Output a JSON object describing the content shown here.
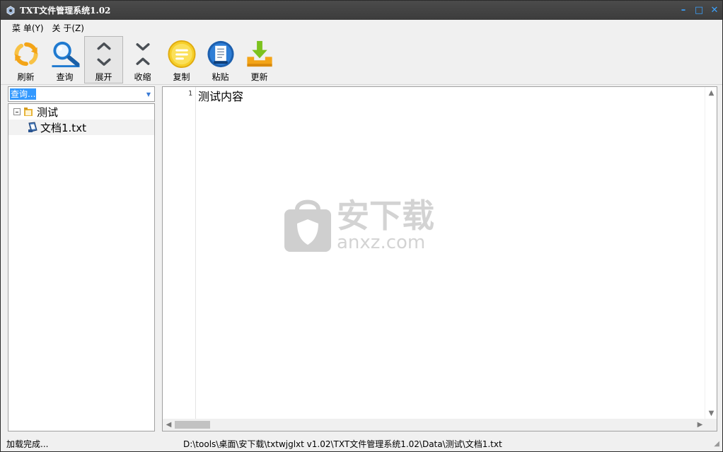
{
  "window": {
    "title": "TXT文件管理系统1.02",
    "controls": {
      "minimize": "–",
      "maximize": "□",
      "close": "✕"
    }
  },
  "menu": [
    {
      "label": "菜 单(Y)"
    },
    {
      "label": "关 于(Z)"
    }
  ],
  "toolbar": {
    "refresh": {
      "label": "刷新",
      "icon": "refresh-icon"
    },
    "search": {
      "label": "查询",
      "icon": "magnifier-icon"
    },
    "expand": {
      "label": "展开",
      "icon": "chevrons-expand-icon"
    },
    "collapse": {
      "label": "收缩",
      "icon": "chevrons-collapse-icon"
    },
    "copy": {
      "label": "复制",
      "icon": "copy-icon"
    },
    "paste": {
      "label": "粘贴",
      "icon": "paste-icon"
    },
    "update": {
      "label": "更新",
      "icon": "download-icon"
    }
  },
  "search_combo": {
    "value": "查询..."
  },
  "tree": {
    "folder": {
      "label": "测试",
      "expanded": true
    },
    "file": {
      "label": "文档1.txt",
      "selected": true
    }
  },
  "editor": {
    "line_number": "1",
    "content": "测试内容"
  },
  "watermark": {
    "cn": "安下载",
    "en": "anxz.com"
  },
  "status": {
    "message": "加载完成...",
    "path": "D:\\tools\\桌面\\安下载\\txtwjglxt v1.02\\TXT文件管理系统1.02\\Data\\测试\\文档1.txt"
  },
  "colors": {
    "titlebar": "#3c3c3c",
    "accent": "#3ba2ff",
    "selection": "#3399ff"
  }
}
